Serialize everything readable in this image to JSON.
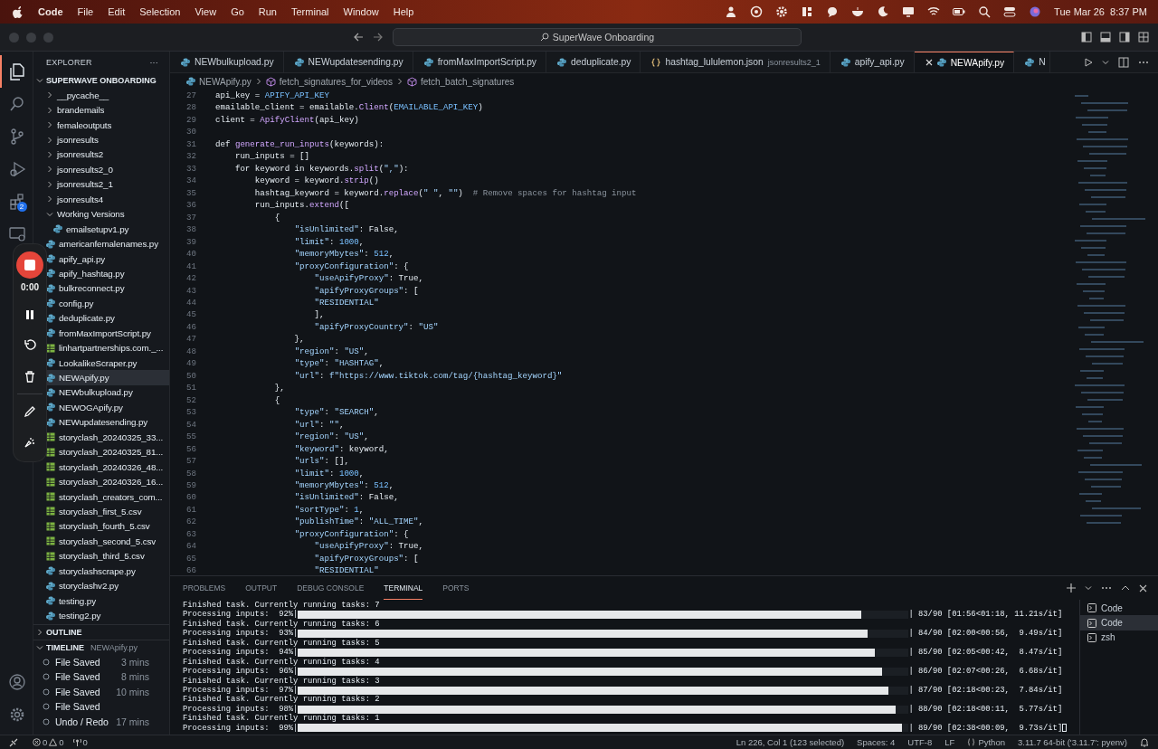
{
  "menu_bar": {
    "app": "Code",
    "items": [
      "File",
      "Edit",
      "Selection",
      "View",
      "Go",
      "Run",
      "Terminal",
      "Window",
      "Help"
    ],
    "clock": "Tue Mar 26  8:37 PM"
  },
  "title_bar": {
    "search": "SuperWave Onboarding"
  },
  "activity_bar": {
    "items": [
      {
        "kind": "files",
        "selected": true
      },
      {
        "kind": "search",
        "selected": false
      },
      {
        "kind": "source",
        "selected": false
      },
      {
        "kind": "debug",
        "selected": false
      },
      {
        "kind": "extensions",
        "selected": false,
        "badge": "2"
      },
      {
        "kind": "remote",
        "selected": false
      }
    ]
  },
  "sidebar": {
    "title": "EXPLORER",
    "more": "···",
    "tree": {
      "label": "SUPERWAVE ONBOARDING",
      "expanded": true,
      "children": [
        {
          "label": "__pycache__",
          "kind": "folder",
          "expanded": false,
          "selected": false
        },
        {
          "label": "brandemails",
          "kind": "folder",
          "expanded": false,
          "selected": false
        },
        {
          "label": "femaleoutputs",
          "kind": "folder",
          "expanded": false,
          "selected": false
        },
        {
          "label": "jsonresults",
          "kind": "folder",
          "expanded": false,
          "selected": false
        },
        {
          "label": "jsonresults2",
          "kind": "folder",
          "expanded": false,
          "selected": false
        },
        {
          "label": "jsonresults2_0",
          "kind": "folder",
          "expanded": false,
          "selected": false
        },
        {
          "label": "jsonresults2_1",
          "kind": "folder",
          "expanded": false,
          "selected": false
        },
        {
          "label": "jsonresults4",
          "kind": "folder",
          "expanded": false,
          "selected": false
        },
        {
          "label": "Working Versions",
          "kind": "folder",
          "expanded": true,
          "selected": false,
          "children": [
            {
              "label": "emailsetupv1.py",
              "kind": "python",
              "selected": false
            }
          ]
        },
        {
          "label": "americanfemalenames.py",
          "kind": "python",
          "selected": false
        },
        {
          "label": "apify_api.py",
          "kind": "python",
          "selected": false
        },
        {
          "label": "apify_hashtag.py",
          "kind": "python",
          "selected": false
        },
        {
          "label": "bulkreconnect.py",
          "kind": "python",
          "selected": false
        },
        {
          "label": "config.py",
          "kind": "python",
          "selected": false
        },
        {
          "label": "deduplicate.py",
          "kind": "python",
          "selected": false
        },
        {
          "label": "fromMaxImportScript.py",
          "kind": "python",
          "selected": false
        },
        {
          "label": "linhartpartnerships.com._...",
          "kind": "csv",
          "selected": false
        },
        {
          "label": "LookalikeScraper.py",
          "kind": "python",
          "selected": false
        },
        {
          "label": "NEWApify.py",
          "kind": "python",
          "selected": true
        },
        {
          "label": "NEWbulkupload.py",
          "kind": "python",
          "selected": false
        },
        {
          "label": "NEWOGApify.py",
          "kind": "python",
          "selected": false
        },
        {
          "label": "NEWupdatesending.py",
          "kind": "python",
          "selected": false
        },
        {
          "label": "storyclash_20240325_33...",
          "kind": "csv",
          "selected": false
        },
        {
          "label": "storyclash_20240325_81...",
          "kind": "csv",
          "selected": false
        },
        {
          "label": "storyclash_20240326_48...",
          "kind": "csv",
          "selected": false
        },
        {
          "label": "storyclash_20240326_16...",
          "kind": "csv",
          "selected": false
        },
        {
          "label": "storyclash_creators_com...",
          "kind": "csv",
          "selected": false
        },
        {
          "label": "storyclash_first_5.csv",
          "kind": "csv",
          "selected": false
        },
        {
          "label": "storyclash_fourth_5.csv",
          "kind": "csv",
          "selected": false
        },
        {
          "label": "storyclash_second_5.csv",
          "kind": "csv",
          "selected": false
        },
        {
          "label": "storyclash_third_5.csv",
          "kind": "csv",
          "selected": false
        },
        {
          "label": "storyclashscrape.py",
          "kind": "python",
          "selected": false
        },
        {
          "label": "storyclashv2.py",
          "kind": "python",
          "selected": false
        },
        {
          "label": "testing.py",
          "kind": "python",
          "selected": false
        },
        {
          "label": "testing2.py",
          "kind": "python",
          "selected": false
        }
      ]
    },
    "outline": {
      "title": "OUTLINE",
      "expanded": false
    },
    "timeline": {
      "title": "TIMELINE",
      "file": "NEWApify.py",
      "expanded": true,
      "items": [
        {
          "label": "File Saved",
          "time": "3 mins"
        },
        {
          "label": "File Saved",
          "time": "8 mins"
        },
        {
          "label": "File Saved",
          "time": "10 mins"
        },
        {
          "label": "File Saved"
        },
        {
          "label": "Undo / Redo",
          "time": "17 mins"
        }
      ]
    }
  },
  "recorder": {
    "time": "0:00"
  },
  "editor": {
    "tabs": [
      {
        "label": "NEWbulkupload.py",
        "kind": "python",
        "selected": false
      },
      {
        "label": "NEWupdatesending.py",
        "kind": "python",
        "selected": false
      },
      {
        "label": "fromMaxImportScript.py",
        "kind": "python",
        "selected": false
      },
      {
        "label": "deduplicate.py",
        "kind": "python",
        "selected": false
      },
      {
        "label": "hashtag_lululemon.json",
        "kind": "json",
        "selected": false,
        "description": "jsonresults2_1"
      },
      {
        "label": "apify_api.py",
        "kind": "python",
        "selected": false
      },
      {
        "label": "NEWApify.py",
        "kind": "python",
        "selected": true
      },
      {
        "label": "N",
        "kind": "python",
        "selected": false
      }
    ],
    "breadcrumbs": [
      {
        "label": "NEWApify.py",
        "kind": "python"
      },
      {
        "label": "fetch_signatures_for_videos",
        "kind": "symbol"
      },
      {
        "label": "fetch_batch_signatures",
        "kind": "symbol"
      }
    ],
    "lines": [
      {
        "no": "27",
        "text": "api_key = APIFY_API_KEY"
      },
      {
        "no": "28",
        "text": "emailable_client = emailable.Client(EMAILABLE_API_KEY)"
      },
      {
        "no": "29",
        "text": "client = ApifyClient(api_key)"
      },
      {
        "no": "30"
      },
      {
        "no": "31",
        "text": "def generate_run_inputs(keywords):"
      },
      {
        "no": "32",
        "text": "    run_inputs = []"
      },
      {
        "no": "33",
        "text": "    for keyword in keywords.split(\",\"):"
      },
      {
        "no": "34",
        "text": "        keyword = keyword.strip()"
      },
      {
        "no": "35",
        "text": "        hashtag_keyword = keyword.replace(\" \", \"\")  # Remove spaces for hashtag input"
      },
      {
        "no": "36",
        "text": "        run_inputs.extend(["
      },
      {
        "no": "37",
        "text": "            {"
      },
      {
        "no": "38",
        "text": "                \"isUnlimited\": False,"
      },
      {
        "no": "39",
        "text": "                \"limit\": 1000,"
      },
      {
        "no": "40",
        "text": "                \"memoryMbytes\": 512,"
      },
      {
        "no": "41",
        "text": "                \"proxyConfiguration\": {"
      },
      {
        "no": "42",
        "text": "                    \"useApifyProxy\": True,"
      },
      {
        "no": "43",
        "text": "                    \"apifyProxyGroups\": ["
      },
      {
        "no": "44",
        "text": "                    \"RESIDENTIAL\""
      },
      {
        "no": "45",
        "text": "                    ],"
      },
      {
        "no": "46",
        "text": "                    \"apifyProxyCountry\": \"US\""
      },
      {
        "no": "47",
        "text": "                },"
      },
      {
        "no": "48",
        "text": "                \"region\": \"US\","
      },
      {
        "no": "49",
        "text": "                \"type\": \"HASHTAG\","
      },
      {
        "no": "50",
        "text": "                \"url\": f\"https://www.tiktok.com/tag/{hashtag_keyword}\""
      },
      {
        "no": "51",
        "text": "            },"
      },
      {
        "no": "52",
        "text": "            {"
      },
      {
        "no": "53",
        "text": "                \"type\": \"SEARCH\","
      },
      {
        "no": "54",
        "text": "                \"url\": \"\","
      },
      {
        "no": "55",
        "text": "                \"region\": \"US\","
      },
      {
        "no": "56",
        "text": "                \"keyword\": keyword,"
      },
      {
        "no": "57",
        "text": "                \"urls\": [],"
      },
      {
        "no": "58",
        "text": "                \"limit\": 1000,"
      },
      {
        "no": "59",
        "text": "                \"memoryMbytes\": 512,"
      },
      {
        "no": "60",
        "text": "                \"isUnlimited\": False,"
      },
      {
        "no": "61",
        "text": "                \"sortType\": 1,"
      },
      {
        "no": "62",
        "text": "                \"publishTime\": \"ALL_TIME\","
      },
      {
        "no": "63",
        "text": "                \"proxyConfiguration\": {"
      },
      {
        "no": "64",
        "text": "                    \"useApifyProxy\": True,"
      },
      {
        "no": "65",
        "text": "                    \"apifyProxyGroups\": ["
      },
      {
        "no": "66",
        "text": "                    \"RESIDENTIAL\""
      }
    ]
  },
  "panel": {
    "tabs": [
      {
        "label": "PROBLEMS",
        "selected": false
      },
      {
        "label": "OUTPUT",
        "selected": false
      },
      {
        "label": "DEBUG CONSOLE",
        "selected": false
      },
      {
        "label": "TERMINAL",
        "selected": true
      },
      {
        "label": "PORTS",
        "selected": false
      }
    ],
    "terminal": [
      {
        "kind": "text",
        "text": "Finished task. Currently running tasks: 7"
      },
      {
        "kind": "progress",
        "label": "Processing inputs:  92%|",
        "level": 0.922,
        "stats": "| 83/90 [01:56<01:18, 11.21s/it]"
      },
      {
        "kind": "text",
        "text": "Finished task. Currently running tasks: 6"
      },
      {
        "kind": "progress",
        "label": "Processing inputs:  93%|",
        "level": 0.933,
        "stats": "| 84/90 [02:00<00:56,  9.49s/it]"
      },
      {
        "kind": "text",
        "text": "Finished task. Currently running tasks: 5"
      },
      {
        "kind": "progress",
        "label": "Processing inputs:  94%|",
        "level": 0.944,
        "stats": "| 85/90 [02:05<00:42,  8.47s/it]"
      },
      {
        "kind": "text",
        "text": "Finished task. Currently running tasks: 4"
      },
      {
        "kind": "progress",
        "label": "Processing inputs:  96%|",
        "level": 0.956,
        "stats": "| 86/90 [02:07<00:26,  6.68s/it]"
      },
      {
        "kind": "text",
        "text": "Finished task. Currently running tasks: 3"
      },
      {
        "kind": "progress",
        "label": "Processing inputs:  97%|",
        "level": 0.967,
        "stats": "| 87/90 [02:18<00:23,  7.84s/it]"
      },
      {
        "kind": "text",
        "text": "Finished task. Currently running tasks: 2"
      },
      {
        "kind": "progress",
        "label": "Processing inputs:  98%|",
        "level": 0.978,
        "stats": "| 88/90 [02:18<00:11,  5.77s/it]"
      },
      {
        "kind": "text",
        "text": "Finished task. Currently running tasks: 1"
      },
      {
        "kind": "progress",
        "label": "Processing inputs:  99%|",
        "level": 0.989,
        "stats": "| 89/90 [02:38<00:09,  9.73s/it]"
      }
    ],
    "sessions": [
      {
        "label": "Code",
        "selected": false
      },
      {
        "label": "Code",
        "selected": true
      },
      {
        "label": "zsh",
        "selected": false
      }
    ]
  },
  "status_bar": {
    "errors": "0",
    "warnings": "0",
    "ports": "0",
    "items": [
      "Ln 226, Col 1 (123 selected)",
      "Spaces: 4",
      "UTF-8",
      "LF",
      "Python",
      "3.11.7 64-bit ('3.11.7': pyenv)"
    ]
  }
}
